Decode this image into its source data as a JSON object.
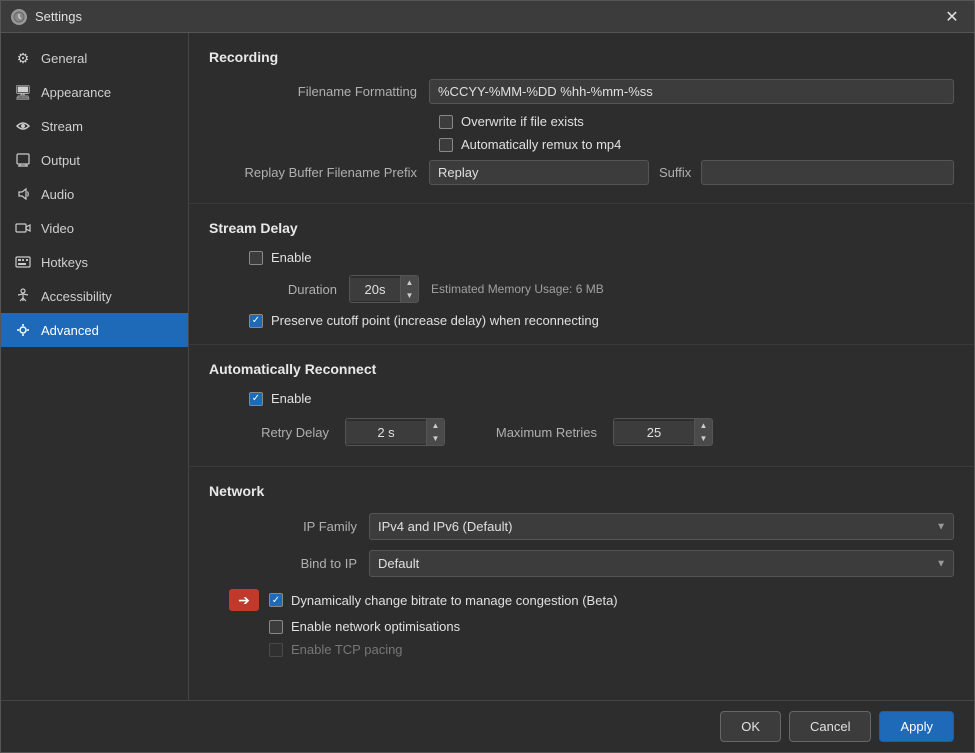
{
  "window": {
    "title": "Settings",
    "close_label": "✕"
  },
  "sidebar": {
    "items": [
      {
        "id": "general",
        "label": "General",
        "icon": "⚙"
      },
      {
        "id": "appearance",
        "label": "Appearance",
        "icon": "🖥"
      },
      {
        "id": "stream",
        "label": "Stream",
        "icon": "📡"
      },
      {
        "id": "output",
        "label": "Output",
        "icon": "📤"
      },
      {
        "id": "audio",
        "label": "Audio",
        "icon": "🔊"
      },
      {
        "id": "video",
        "label": "Video",
        "icon": "🎬"
      },
      {
        "id": "hotkeys",
        "label": "Hotkeys",
        "icon": "⌨"
      },
      {
        "id": "accessibility",
        "label": "Accessibility",
        "icon": "♿"
      },
      {
        "id": "advanced",
        "label": "Advanced",
        "icon": "🔧",
        "active": true
      }
    ]
  },
  "sections": {
    "recording": {
      "title": "Recording",
      "filename_label": "Filename Formatting",
      "filename_value": "%CCYY-%MM-%DD %hh-%mm-%ss",
      "overwrite_label": "Overwrite if file exists",
      "remux_label": "Automatically remux to mp4",
      "replay_prefix_label": "Replay Buffer Filename Prefix",
      "replay_prefix_value": "Replay",
      "suffix_label": "Suffix",
      "suffix_value": ""
    },
    "stream_delay": {
      "title": "Stream Delay",
      "enable_label": "Enable",
      "duration_label": "Duration",
      "duration_value": "20s",
      "estimated_label": "Estimated Memory Usage: 6 MB",
      "preserve_label": "Preserve cutoff point (increase delay) when reconnecting"
    },
    "auto_reconnect": {
      "title": "Automatically Reconnect",
      "enable_label": "Enable",
      "retry_delay_label": "Retry Delay",
      "retry_delay_value": "2 s",
      "max_retries_label": "Maximum Retries",
      "max_retries_value": "25"
    },
    "network": {
      "title": "Network",
      "ip_family_label": "IP Family",
      "ip_family_value": "IPv4 and IPv6 (Default)",
      "bind_to_ip_label": "Bind to IP",
      "bind_to_ip_value": "Default",
      "dynamically_label": "Dynamically change bitrate to manage congestion (Beta)",
      "network_opt_label": "Enable network optimisations",
      "tcp_pacing_label": "Enable TCP pacing"
    }
  },
  "footer": {
    "ok_label": "OK",
    "cancel_label": "Cancel",
    "apply_label": "Apply"
  }
}
